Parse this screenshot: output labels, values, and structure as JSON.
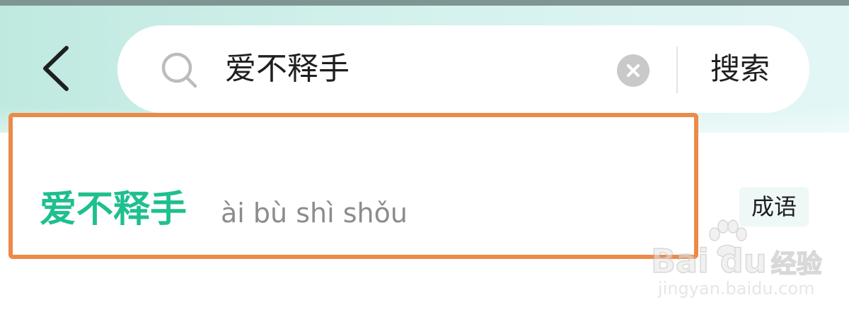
{
  "header": {
    "back_icon": "chevron-left-icon",
    "search": {
      "icon": "search-icon",
      "value": "爱不释手",
      "clear_icon": "close-icon",
      "submit_label": "搜索"
    }
  },
  "results": [
    {
      "word": "爱不释手",
      "pinyin": "ài bù shì shǒu",
      "tag": "成语"
    }
  ],
  "watermark": {
    "logo": "Bai du",
    "logo_cn": "经验",
    "url": "jingyan.baidu.com"
  },
  "colors": {
    "accent_green": "#1fbf8f",
    "highlight_orange": "#ec8a48",
    "header_teal": "#bfe9e0"
  }
}
